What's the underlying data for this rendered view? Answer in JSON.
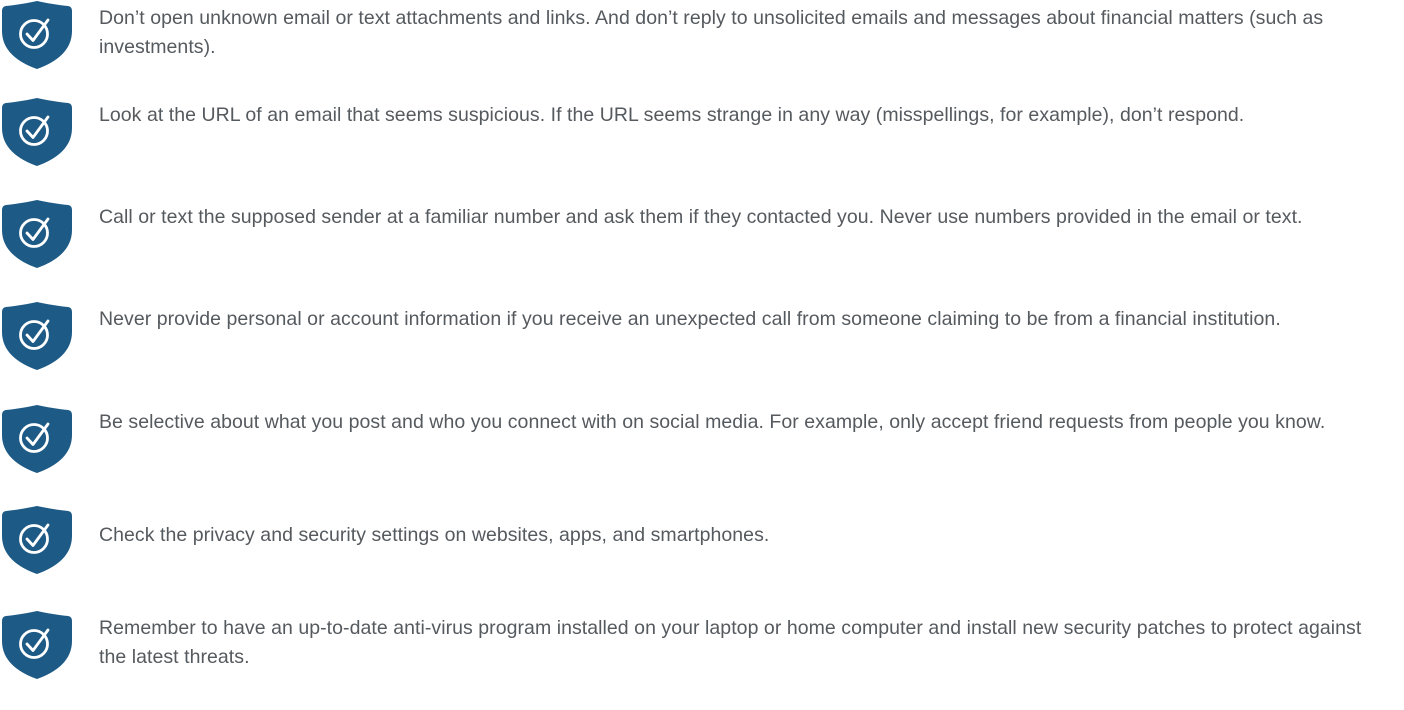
{
  "colors": {
    "shield": "#1d5a86",
    "check": "#ffffff",
    "text": "#555a5f"
  },
  "icon": "shield-check-icon",
  "tips": [
    {
      "text": "Don’t open unknown email or text attachments and links. And don’t reply to unsolicited emails and messages about financial matters (such as investments)."
    },
    {
      "text": "Look at the URL of an email that seems suspicious. If the URL seems strange in any way (misspellings, for example), don’t respond."
    },
    {
      "text": "Call or text the supposed sender at a familiar number and ask them if they contacted you. Never use numbers provided in the email or text."
    },
    {
      "text": "Never provide personal or account information if you receive an unexpected call from someone claiming to be from a financial institution."
    },
    {
      "text": "Be selective about what you post and who you connect with on social media. For example, only accept friend requests from people you know."
    },
    {
      "text": "Check the privacy and security settings on websites, apps, and smartphones."
    },
    {
      "text": "Remember to have an up-to-date anti-virus program installed on your laptop or home computer and install new security patches to protect against the latest threats."
    }
  ]
}
